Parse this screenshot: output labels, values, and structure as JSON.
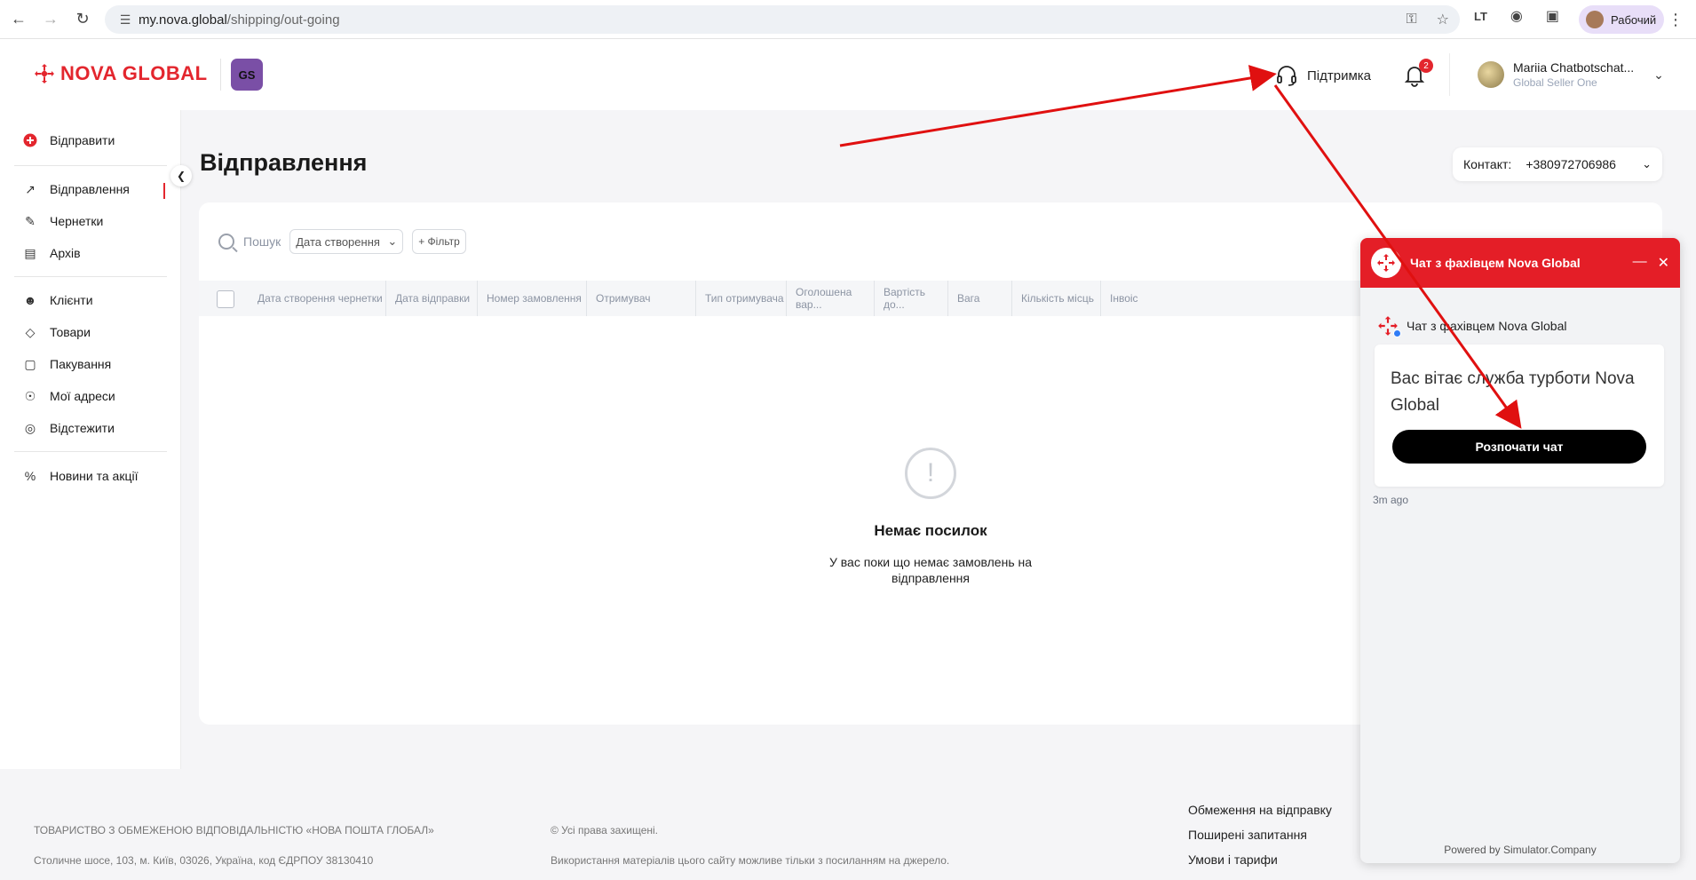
{
  "browser": {
    "url_host": "my.nova.global",
    "url_path": "/shipping/out-going",
    "profile_label": "Рабочий",
    "icons": [
      "back-icon",
      "forward-icon",
      "reload-icon",
      "site-settings-icon",
      "password-key-icon",
      "bookmark-star-icon",
      "extension-icon",
      "camera-icon",
      "puzzle-icon",
      "kebab-menu-icon"
    ]
  },
  "header": {
    "logo_text": "NOVA GLOBAL",
    "badge_text": "GS",
    "support_label": "Підтримка",
    "notification_count": "2",
    "user_name": "Mariia Chatbotschat...",
    "user_company": "Global Seller One"
  },
  "sidebar": {
    "send_label": "Відправити",
    "items": [
      {
        "label": "Відправлення",
        "icon": "arrow-up-right-icon"
      },
      {
        "label": "Чернетки",
        "icon": "edit-icon"
      },
      {
        "label": "Архів",
        "icon": "archive-icon"
      },
      {
        "label": "Клієнти",
        "icon": "users-icon"
      },
      {
        "label": "Товари",
        "icon": "tag-icon"
      },
      {
        "label": "Пакування",
        "icon": "box-icon"
      },
      {
        "label": "Мої адреси",
        "icon": "location-user-icon"
      },
      {
        "label": "Відстежити",
        "icon": "track-icon"
      },
      {
        "label": "Новини та акції",
        "icon": "percent-icon"
      }
    ]
  },
  "main": {
    "title": "Відправлення",
    "contact_label": "Контакт:",
    "contact_phone": "+380972706986",
    "search_placeholder": "Пошук",
    "date_filter": "Дата створення",
    "filter_button": "+ Фільтр",
    "columns": [
      "Дата створення чернетки",
      "Дата відправки",
      "Номер замовлення",
      "Отримувач",
      "Тип отримувача",
      "Оголошена вар...",
      "Вартість до...",
      "Вага",
      "Кількість місць",
      "Інвоіс"
    ],
    "empty_title": "Немає посилок",
    "empty_desc": "У вас поки що немає замовлень на відправлення"
  },
  "footer": {
    "company": "ТОВАРИСТВО З ОБМЕЖЕНОЮ ВІДПОВІДАЛЬНІСТЮ «НОВА ПОШТА ГЛОБАЛ»",
    "address": "Столичне шосе, 103, м. Київ, 03026, Україна, код ЄДРПОУ 38130410",
    "rights": "© Усі права захищені.",
    "usage": "Використання матеріалів цього сайту можливе тільки з посиланням на джерело.",
    "links": [
      "Обмеження на відправку",
      "Поширені запитання",
      "Умови і тарифи"
    ]
  },
  "chat": {
    "header_title": "Чат з фахівцем Nova Global",
    "agent_name": "Чат з фахівцем Nova Global",
    "message": "Вас вітає служба турботи Nova Global",
    "start_button": "Розпочати чат",
    "time": "3m ago",
    "powered_by": "Powered by Simulator.Company"
  },
  "colors": {
    "brand_red": "#e3262e",
    "chat_red": "#e41e27",
    "gs_purple": "#7a4fa6"
  }
}
